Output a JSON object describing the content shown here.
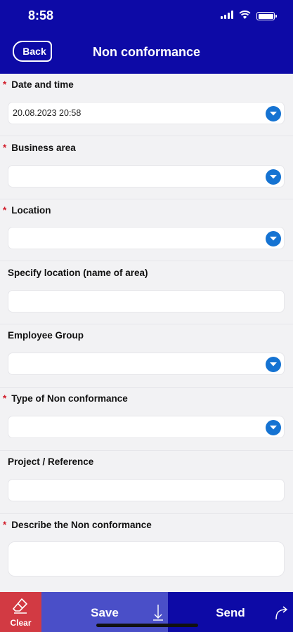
{
  "status": {
    "time": "8:58"
  },
  "header": {
    "back_label": "Back",
    "title": "Non conformance"
  },
  "fields": [
    {
      "label": "Date and time",
      "required": true,
      "type": "dropdown",
      "value": "20.08.2023 20:58"
    },
    {
      "label": "Business area",
      "required": true,
      "type": "dropdown",
      "value": ""
    },
    {
      "label": "Location",
      "required": true,
      "type": "dropdown",
      "value": ""
    },
    {
      "label": "Specify location (name of area)",
      "required": false,
      "type": "text",
      "value": ""
    },
    {
      "label": "Employee Group",
      "required": false,
      "type": "dropdown",
      "value": ""
    },
    {
      "label": "Type of Non conformance",
      "required": true,
      "type": "dropdown",
      "value": ""
    },
    {
      "label": "Project / Reference",
      "required": false,
      "type": "text",
      "value": ""
    },
    {
      "label": "Describe the Non conformance",
      "required": true,
      "type": "textarea",
      "value": ""
    }
  ],
  "required_marker": "*",
  "toolbar": {
    "clear_label": "Clear",
    "save_label": "Save",
    "send_label": "Send"
  },
  "colors": {
    "primary": "#0d0aa6",
    "accent": "#1573d2",
    "danger": "#d23a43",
    "save": "#4a4fc8"
  }
}
